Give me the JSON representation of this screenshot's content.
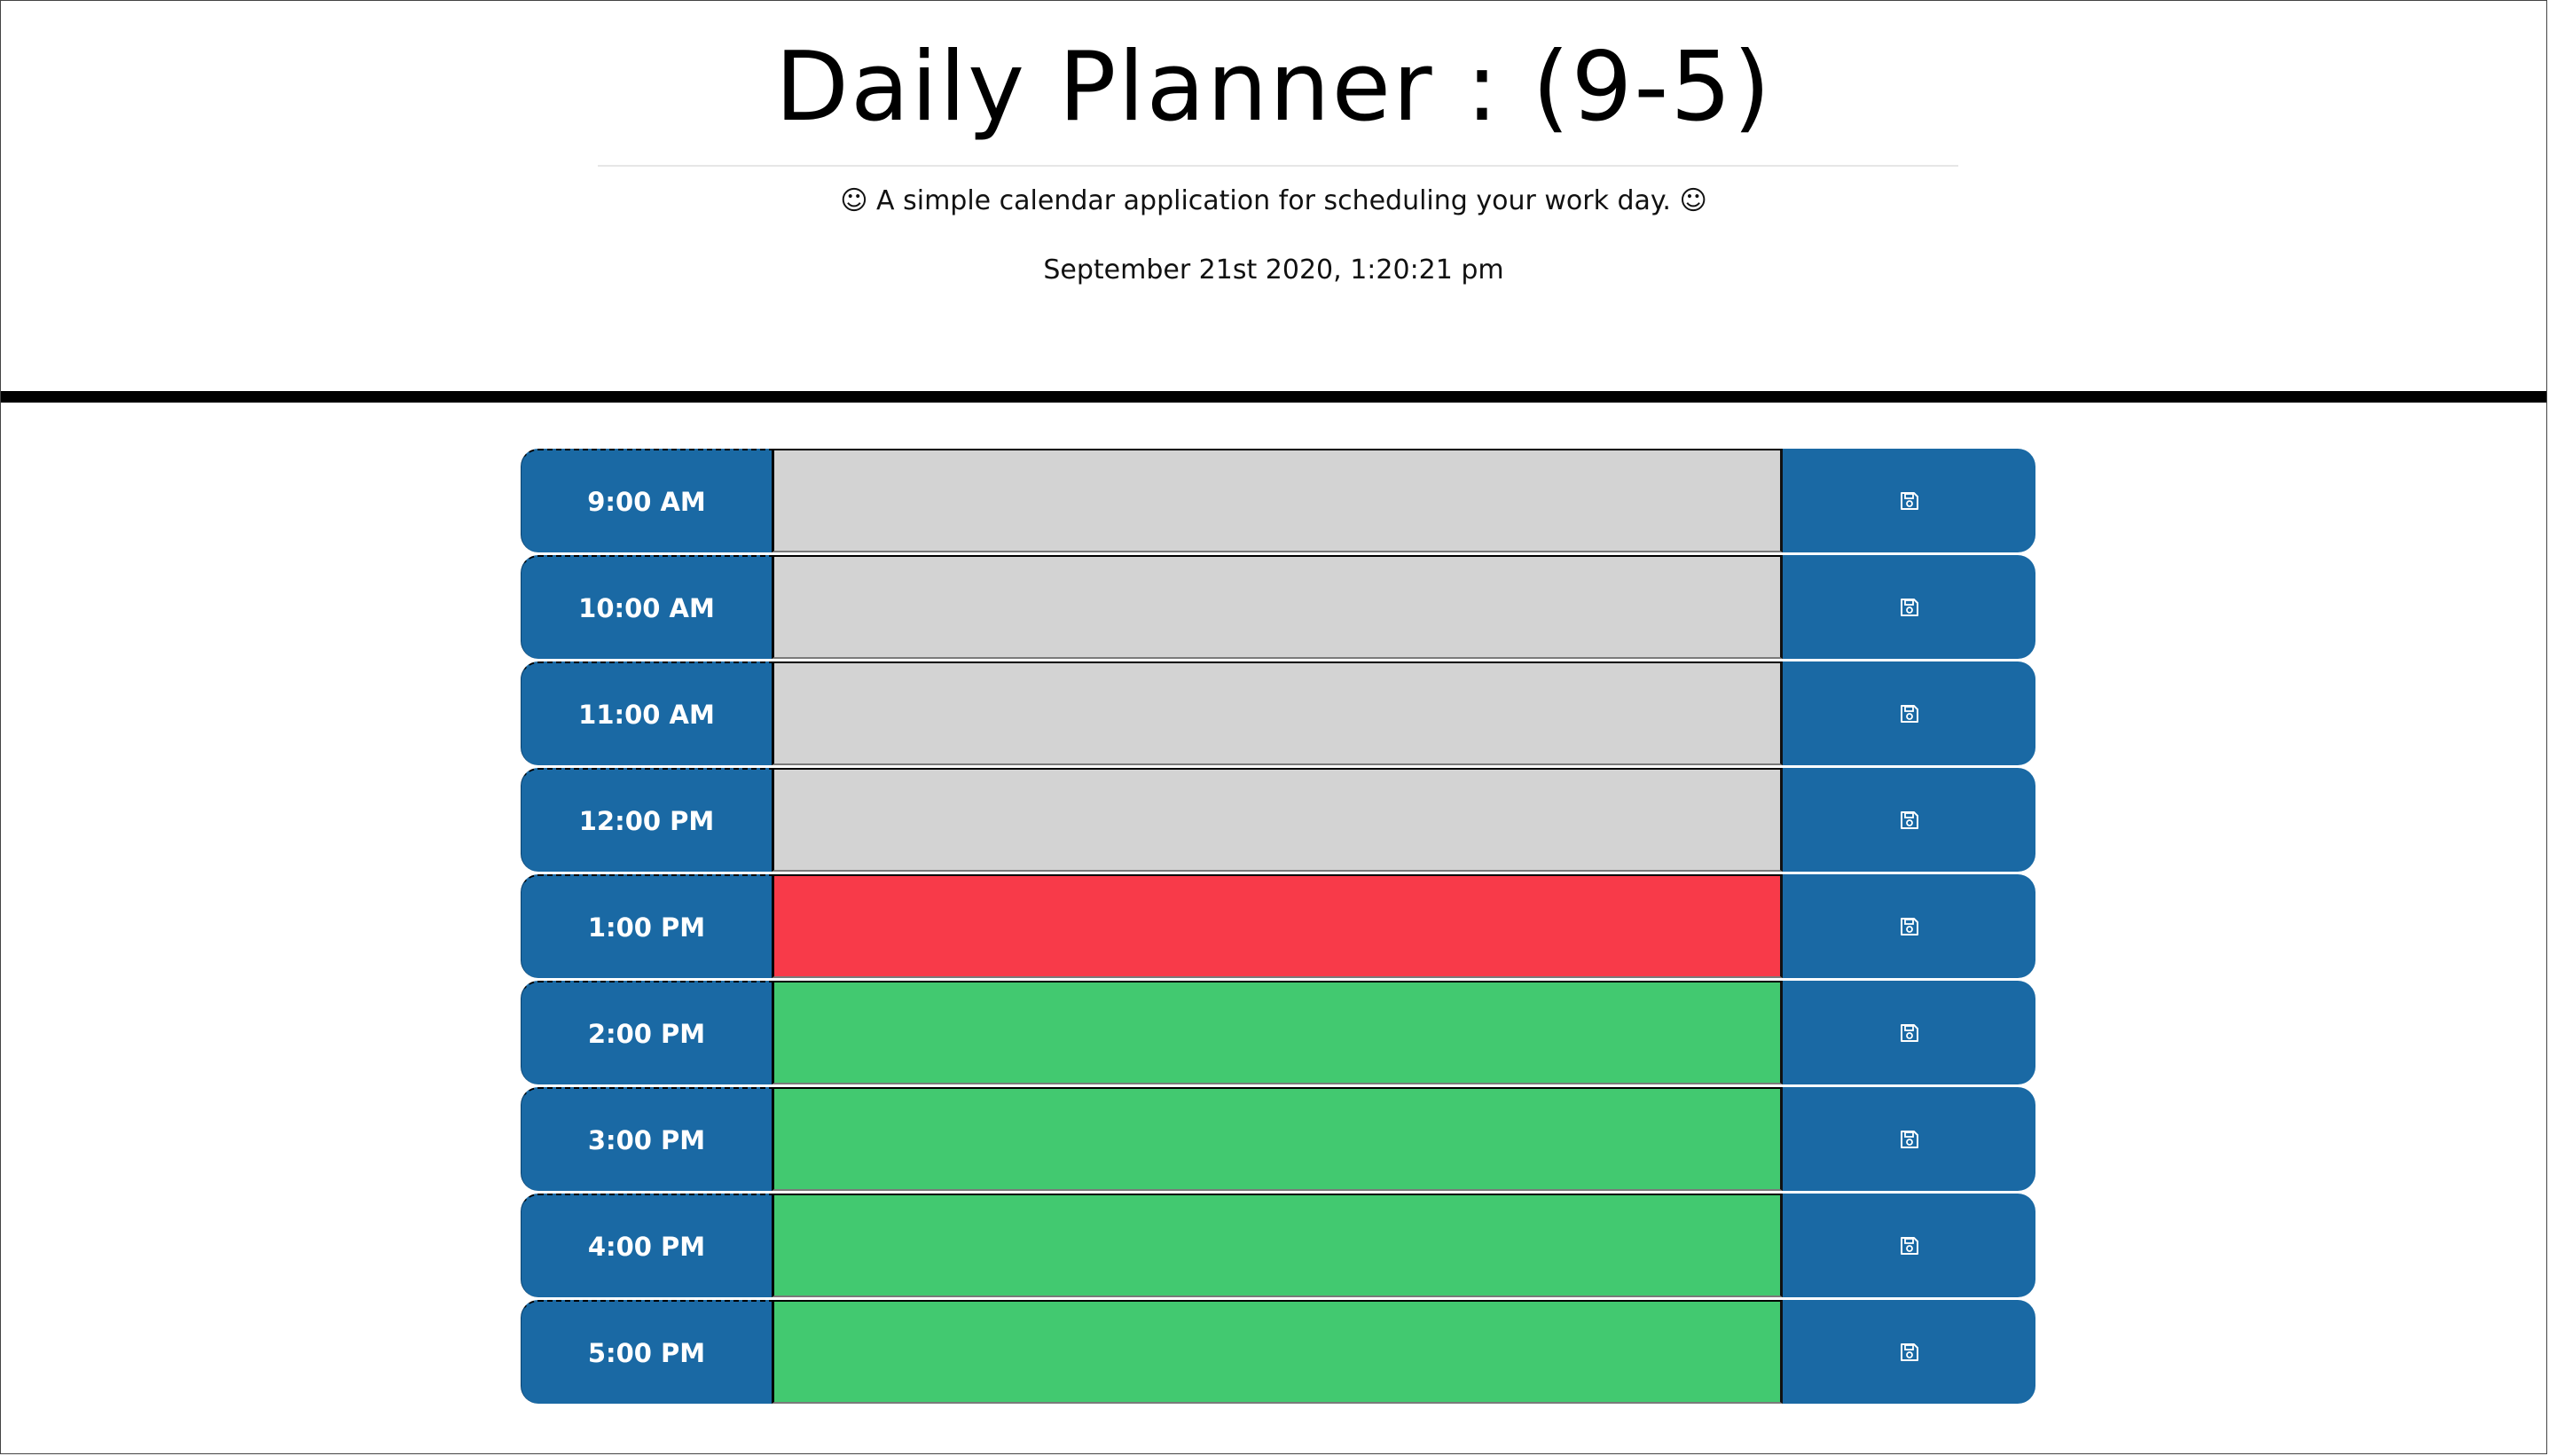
{
  "header": {
    "title": "Daily Planner : (9-5)",
    "lead": "☺ A simple calendar application for scheduling your work day. ☺",
    "current_day": "September 21st 2020, 1:20:21 pm"
  },
  "colors": {
    "hour_block": "#1a69a4",
    "past": "#d3d3d3",
    "present": "#f83a49",
    "future": "#42c970"
  },
  "rows": [
    {
      "hour": "9:00 AM",
      "status": "past",
      "text": "",
      "save_icon": "floppy-disk-icon"
    },
    {
      "hour": "10:00 AM",
      "status": "past",
      "text": "",
      "save_icon": "floppy-disk-icon"
    },
    {
      "hour": "11:00 AM",
      "status": "past",
      "text": "",
      "save_icon": "floppy-disk-icon"
    },
    {
      "hour": "12:00 PM",
      "status": "past",
      "text": "",
      "save_icon": "floppy-disk-icon"
    },
    {
      "hour": "1:00 PM",
      "status": "present",
      "text": "",
      "save_icon": "floppy-disk-icon"
    },
    {
      "hour": "2:00 PM",
      "status": "future",
      "text": "",
      "save_icon": "floppy-disk-icon"
    },
    {
      "hour": "3:00 PM",
      "status": "future",
      "text": "",
      "save_icon": "floppy-disk-icon"
    },
    {
      "hour": "4:00 PM",
      "status": "future",
      "text": "",
      "save_icon": "floppy-disk-icon"
    },
    {
      "hour": "5:00 PM",
      "status": "future",
      "text": "",
      "save_icon": "floppy-disk-icon"
    }
  ]
}
